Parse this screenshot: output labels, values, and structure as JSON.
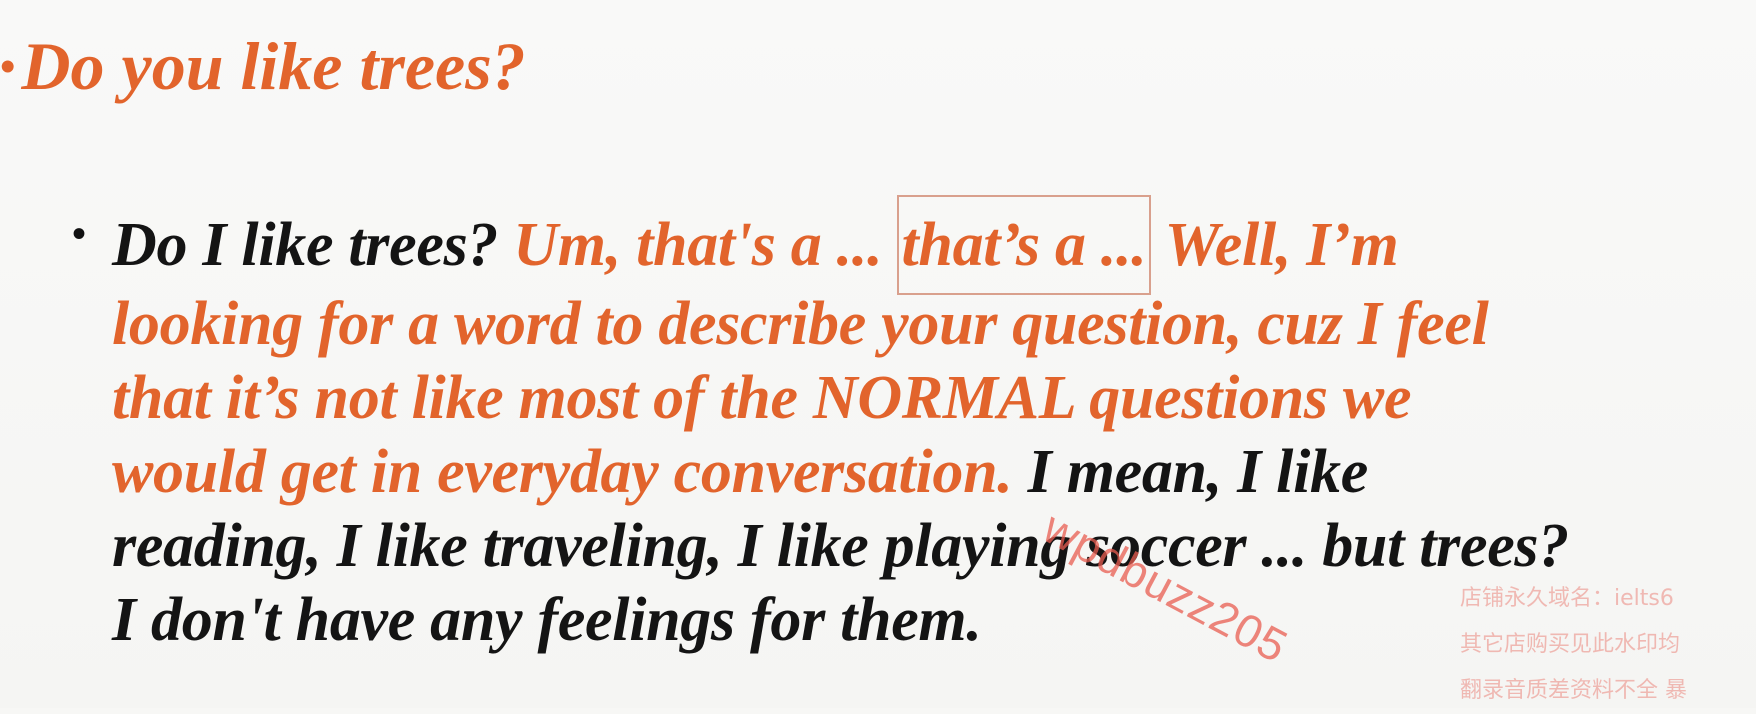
{
  "slide": {
    "question": {
      "bullet": "•",
      "text": "Do you like trees?"
    },
    "answer": {
      "bullet": "•",
      "lines": [
        [
          {
            "text": "Do I like trees? ",
            "color": "black"
          },
          {
            "text": "Um, that's a ... ",
            "color": "orange"
          },
          {
            "text": "that’s a ...",
            "color": "orange",
            "boxed": true
          },
          {
            "text": " Well, I’m",
            "color": "orange"
          }
        ],
        [
          {
            "text": "looking for a word to describe your question, cuz I feel",
            "color": "orange"
          }
        ],
        [
          {
            "text": "that it’s not like most of the NORMAL questions we",
            "color": "orange"
          }
        ],
        [
          {
            "text": "would get in everyday conversation. ",
            "color": "orange"
          },
          {
            "text": "I mean, I like",
            "color": "black"
          }
        ],
        [
          {
            "text": "reading, I like traveling, I like playing soccer ... but trees?",
            "color": "black"
          }
        ],
        [
          {
            "text": "I don't have any feelings for them.",
            "color": "black"
          }
        ]
      ]
    }
  },
  "watermark": {
    "handle": "wpdbuzz205",
    "lines": [
      "店铺永久域名：ielts6",
      "其它店购买见此水印均",
      "翻录音质差资料不全 暴"
    ]
  },
  "colors": {
    "accent": "#e2642c",
    "text": "#141414"
  }
}
